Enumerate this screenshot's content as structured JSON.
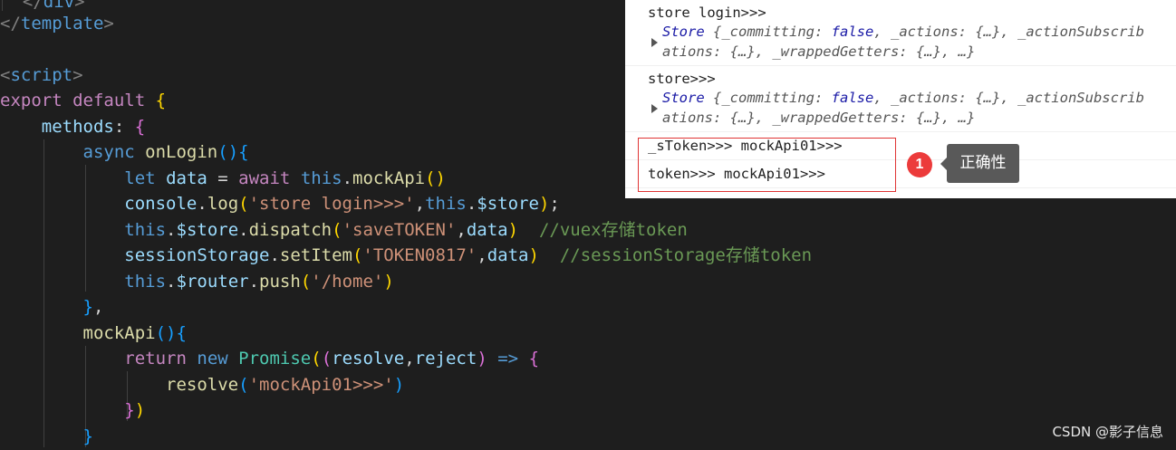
{
  "code": {
    "l0": "</div>",
    "l1": "</template>",
    "l3": "<script>",
    "l4_kw": "export default",
    "l5_prop": "methods",
    "l6_kw": "async",
    "l6_fn": "onLogin",
    "l7_kw": "let",
    "l7_var": "data",
    "l7_await": "await",
    "l7_this": "this",
    "l7_fn": "mockApi",
    "l8_obj": "console",
    "l8_fn": "log",
    "l8_str": "'store login>>>'",
    "l8_this": "this",
    "l8_prop": "$store",
    "l9_this": "this",
    "l9_prop": "$store",
    "l9_fn": "dispatch",
    "l9_str": "'saveTOKEN'",
    "l9_arg": "data",
    "l9_cm": "//vuex存储token",
    "l10_obj": "sessionStorage",
    "l10_fn": "setItem",
    "l10_str": "'TOKEN0817'",
    "l10_arg": "data",
    "l10_cm": "//sessionStorage存储token",
    "l11_this": "this",
    "l11_prop": "$router",
    "l11_fn": "push",
    "l11_str": "'/home'",
    "l13_fn": "mockApi",
    "l14_kw": "return",
    "l14_new": "new",
    "l14_cls": "Promise",
    "l14_a1": "resolve",
    "l14_a2": "reject",
    "l15_fn": "resolve",
    "l15_str": "'mockApi01>>>'"
  },
  "console": {
    "r1_label": "store login>>>",
    "r1_obj": "Store",
    "r1_a": "{_committing: ",
    "r1_false": "false",
    "r1_b": ", _actions: {…}, _actionSubscrib",
    "r1_c": "ations: {…}, _wrappedGetters: {…}, …}",
    "r2_label": "store>>>",
    "r2_obj": "Store",
    "r2_a": "{_committing: ",
    "r2_false": "false",
    "r2_b": ", _actions: {…}, _actionSubscrib",
    "r2_c": "ations: {…}, _wrappedGetters: {…}, …}",
    "r3": "_sToken>>> mockApi01>>>",
    "r4": "token>>> mockApi01>>>"
  },
  "annotation": {
    "badge": "1",
    "tooltip": "正确性"
  },
  "watermark": "CSDN @影子信息",
  "colors": {
    "editor_bg": "#1e1e1e",
    "highlight": "#e03535",
    "badge": "#ec3b3b"
  }
}
